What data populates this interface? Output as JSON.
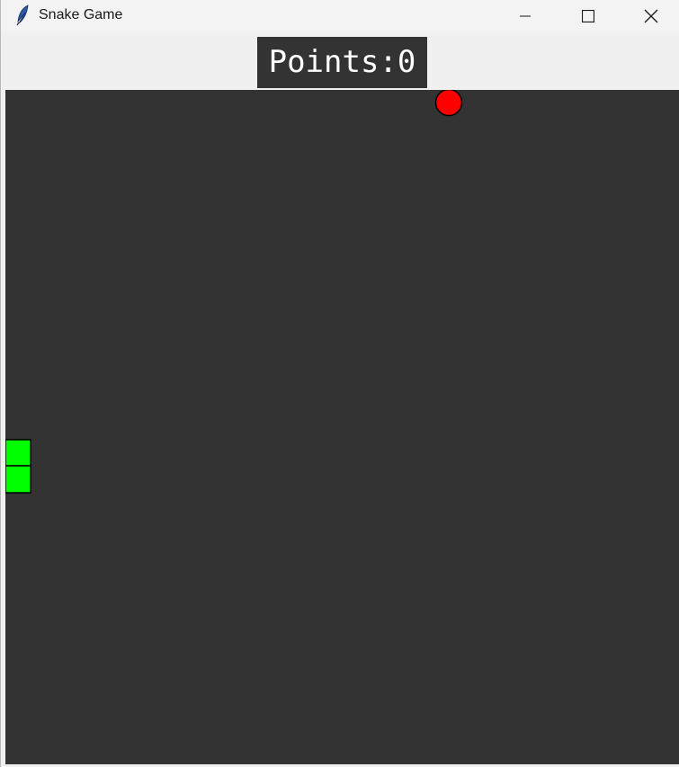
{
  "window": {
    "title": "Snake Game",
    "app_icon": "feather-icon",
    "controls": {
      "minimize_icon": "minimize-icon",
      "maximize_icon": "maximize-icon",
      "close_icon": "close-icon"
    }
  },
  "score": {
    "text": "Points:0",
    "value": 0
  },
  "board": {
    "background_color": "#333333",
    "food": {
      "color": "#ff0000",
      "outline": "#000000"
    },
    "snake": {
      "color": "#00ff00",
      "outline": "#000000",
      "segments": 2
    }
  }
}
